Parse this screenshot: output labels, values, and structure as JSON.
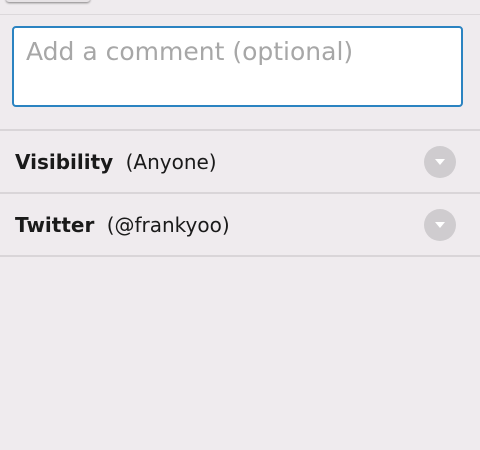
{
  "comment": {
    "placeholder": "Add a comment (optional)",
    "value": ""
  },
  "visibility": {
    "label": "Visibility",
    "value": "(Anyone)",
    "icon": "chevron-down-icon"
  },
  "twitter": {
    "label": "Twitter",
    "value": "(@frankyoo)",
    "icon": "chevron-down-icon"
  },
  "colors": {
    "background": "#efebee",
    "focus_border": "#2b83c1",
    "divider": "#d9d5d8",
    "dropdown_circle": "#cfcccf"
  }
}
